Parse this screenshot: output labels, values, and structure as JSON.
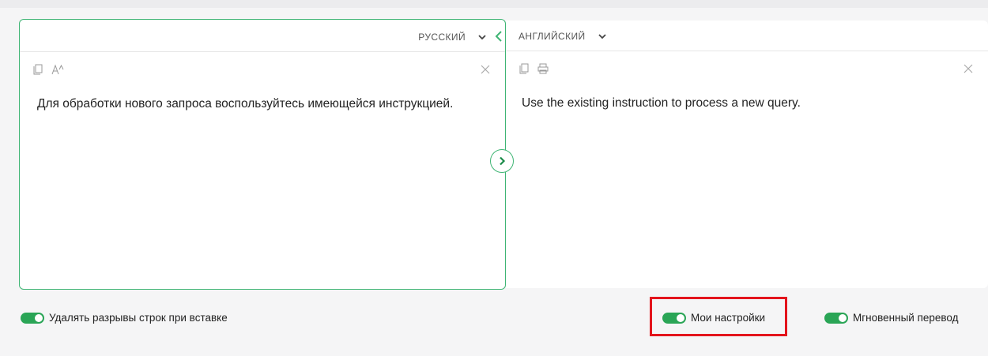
{
  "source": {
    "language": "РУССКИЙ",
    "text": "Для обработки нового запроса воспользуйтесь имеющейся инструкцией."
  },
  "target": {
    "language": "АНГЛИЙСКИЙ",
    "text": "Use the existing instruction to process a new query."
  },
  "toggles": {
    "remove_breaks": {
      "label": "Удалять разрывы строк при вставке",
      "on": true
    },
    "my_settings": {
      "label": "Мои настройки",
      "on": true
    },
    "instant": {
      "label": "Мгновенный перевод",
      "on": true
    }
  },
  "colors": {
    "accent": "#3fb574",
    "toggle": "#2aa556",
    "highlight": "#e3141c"
  }
}
